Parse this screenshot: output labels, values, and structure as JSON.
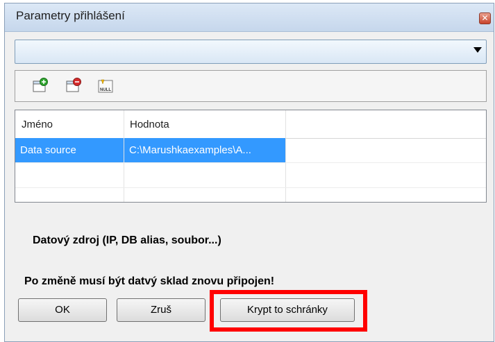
{
  "window": {
    "title": "Parametry přihlášení"
  },
  "titlebar": {
    "close_glyph": "✕"
  },
  "combo": {
    "value": ""
  },
  "toolbar": {
    "items": [
      {
        "icon": "add-parameter-icon"
      },
      {
        "icon": "remove-parameter-icon"
      },
      {
        "icon": "set-null-icon",
        "badge": "NULL"
      }
    ]
  },
  "grid": {
    "columns": [
      "Jméno",
      "Hodnota"
    ],
    "rows": [
      {
        "name": "Data source",
        "value": "C:\\Marushkaexamples\\A...",
        "selected": true
      },
      {
        "name": "",
        "value": ""
      },
      {
        "name": "",
        "value": ""
      }
    ]
  },
  "description": "Datový zdroj (IP, DB alias, soubor...)",
  "warning": "Po změně musí být datvý sklad znovu připojen!",
  "buttons": {
    "ok": "OK",
    "cancel": "Zruš",
    "copy": "Krypt to schránky"
  },
  "colors": {
    "selection": "#3399ff",
    "highlight": "#ff0000"
  }
}
